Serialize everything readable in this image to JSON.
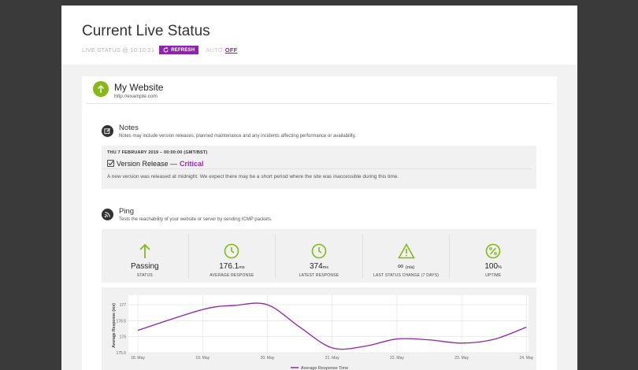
{
  "header": {
    "title": "Current Live Status",
    "live_status": "LIVE STATUS @ 10:10:21",
    "refresh_label": "REFRESH",
    "auto_label": "AUTO",
    "auto_value": "OFF"
  },
  "site": {
    "name": "My Website",
    "url": "http://example.com"
  },
  "notes": {
    "title": "Notes",
    "description": "Notes may include version releases, planned maintenance and any incidents affecting performance or availability.",
    "date": "THU 7 FEBRUARY 2019 – 00:00:00 (GMT/BST)",
    "note_title": "Version Release —",
    "note_severity": "Critical",
    "note_body": "A new version was released at midnight. We expect there may be a short period where the site was inaccessible during this time."
  },
  "ping": {
    "title": "Ping",
    "description": "Tests the reachability of your website or server by sending ICMP packets.",
    "stats": [
      {
        "value": "Passing",
        "unit": "",
        "label": "STATUS",
        "icon": "arrow-up-icon"
      },
      {
        "value": "176.1",
        "unit": "ms",
        "label": "AVERAGE RESPONSE",
        "icon": "clock-icon"
      },
      {
        "value": "374",
        "unit": "ms",
        "label": "LATEST RESPONSE",
        "icon": "clock-icon"
      },
      {
        "value": "∞",
        "unit": "(n/a)",
        "label": "LAST STATUS CHANGE (7 DAYS)",
        "icon": "warning-icon"
      },
      {
        "value": "100",
        "unit": "%",
        "label": "UPTIME",
        "icon": "percent-icon"
      }
    ]
  },
  "colors": {
    "accent": "#8e24aa",
    "success": "#85b819"
  },
  "chart_data": {
    "type": "line",
    "ylabel": "Average Response (ms)",
    "xlabel": "",
    "x": [
      "18. May",
      "19. May",
      "20. May",
      "21. May",
      "22. May",
      "23. May",
      "24. May"
    ],
    "yticks": [
      "175.5",
      "176",
      "176.5",
      "177"
    ],
    "ylim": [
      175.5,
      177.2
    ],
    "series": [
      {
        "name": "Average Response Time",
        "points": [
          [
            0,
            176.2
          ],
          [
            1,
            176.85
          ],
          [
            1.5,
            176.98
          ],
          [
            2,
            177.0
          ],
          [
            2.5,
            176.3
          ],
          [
            3,
            175.65
          ],
          [
            3.5,
            175.7
          ],
          [
            4,
            175.93
          ],
          [
            4.5,
            175.9
          ],
          [
            5,
            175.8
          ],
          [
            5.5,
            175.92
          ],
          [
            6,
            176.3
          ]
        ]
      }
    ],
    "grid": true,
    "legend": "bottom"
  }
}
